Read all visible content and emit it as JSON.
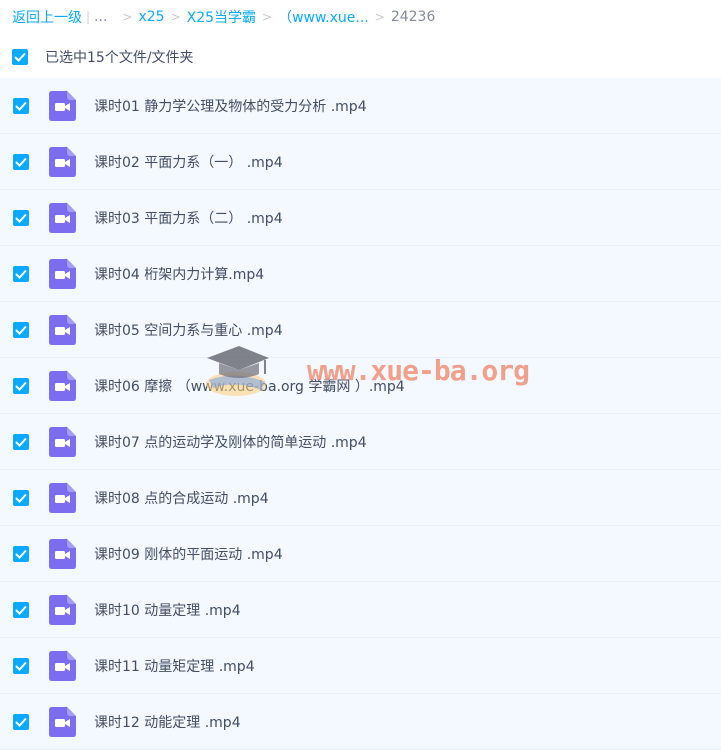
{
  "breadcrumb": {
    "back": "返回上一级",
    "divider": "|",
    "ellipsis": "...",
    "sep": ">",
    "items": [
      "x25",
      "X25当学霸",
      "（www.xue..."
    ],
    "current": "24236"
  },
  "selection": {
    "label": "已选中15个文件/文件夹"
  },
  "files": [
    {
      "name": "课时01 静力学公理及物体的受力分析 .mp4"
    },
    {
      "name": "课时02 平面力系（一） .mp4"
    },
    {
      "name": "课时03 平面力系（二） .mp4"
    },
    {
      "name": "课时04 桁架内力计算.mp4"
    },
    {
      "name": "课时05 空间力系与重心 .mp4"
    },
    {
      "name": "课时06 摩擦 （www.xue-ba.org 学霸网 ）.mp4"
    },
    {
      "name": "课时07 点的运动学及刚体的简单运动 .mp4"
    },
    {
      "name": "课时08 点的合成运动 .mp4"
    },
    {
      "name": "课时09 刚体的平面运动 .mp4"
    },
    {
      "name": "课时10 动量定理 .mp4"
    },
    {
      "name": "课时11 动量矩定理 .mp4"
    },
    {
      "name": "课时12 动能定理 .mp4"
    }
  ],
  "watermark": {
    "text": "www.xue-ba.org"
  },
  "colors": {
    "accent": "#09aaff",
    "video_icon": "#7b6cf0",
    "row_bg": "#f3f9ff"
  },
  "icons": {
    "checkbox": "check-icon",
    "file": "video-file-icon",
    "watermark": "graduation-cap-icon"
  }
}
